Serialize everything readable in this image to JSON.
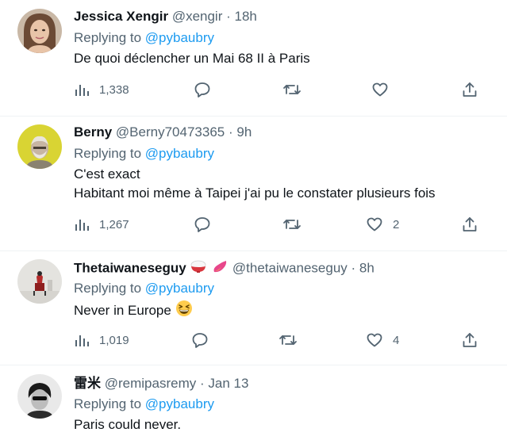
{
  "tweets": [
    {
      "name": "Jessica Xengir",
      "handle": "@xengir",
      "sep": "·",
      "time": "18h",
      "reply_prefix": "Replying to",
      "reply_to": "@pybaubry",
      "lines": [
        "De quoi déclencher un Mai 68 II à Paris"
      ],
      "views": "1,338",
      "replies": "",
      "retweets": "",
      "likes": ""
    },
    {
      "name": "Berny",
      "handle": "@Berny70473365",
      "sep": "·",
      "time": "9h",
      "reply_prefix": "Replying to",
      "reply_to": "@pybaubry",
      "lines": [
        "C'est exact",
        "Habitant moi même à Taipei j'ai pu le constater plusieurs fois"
      ],
      "views": "1,267",
      "replies": "",
      "retweets": "",
      "likes": "2"
    },
    {
      "name": "Thetaiwaneseguy",
      "handle": "@thetaiwaneseguy",
      "sep": "·",
      "time": "8h",
      "reply_prefix": "Replying to",
      "reply_to": "@pybaubry",
      "lines": [
        "Never in Europe"
      ],
      "views": "1,019",
      "replies": "",
      "retweets": "",
      "likes": "4"
    },
    {
      "name": "雷米",
      "handle": "@remipasremy",
      "sep": "·",
      "time": "Jan 13",
      "reply_prefix": "Replying to",
      "reply_to": "@pybaubry",
      "lines": [
        "Paris could never."
      ]
    }
  ],
  "icons": {
    "views": "bar-chart-icon",
    "reply": "speech-bubble-icon",
    "retweet": "retweet-arrows-icon",
    "like": "heart-icon",
    "share": "share-upload-icon",
    "name_emoji_1": "rice-bowl-emoji",
    "name_emoji_2": "sweet-potato-emoji",
    "body_emoji": "grinning-squinting-face-emoji"
  },
  "colors": {
    "link": "#1d9bf0",
    "secondary_text": "#536471",
    "primary_text": "#0f1419",
    "divider": "#eff3f4"
  }
}
